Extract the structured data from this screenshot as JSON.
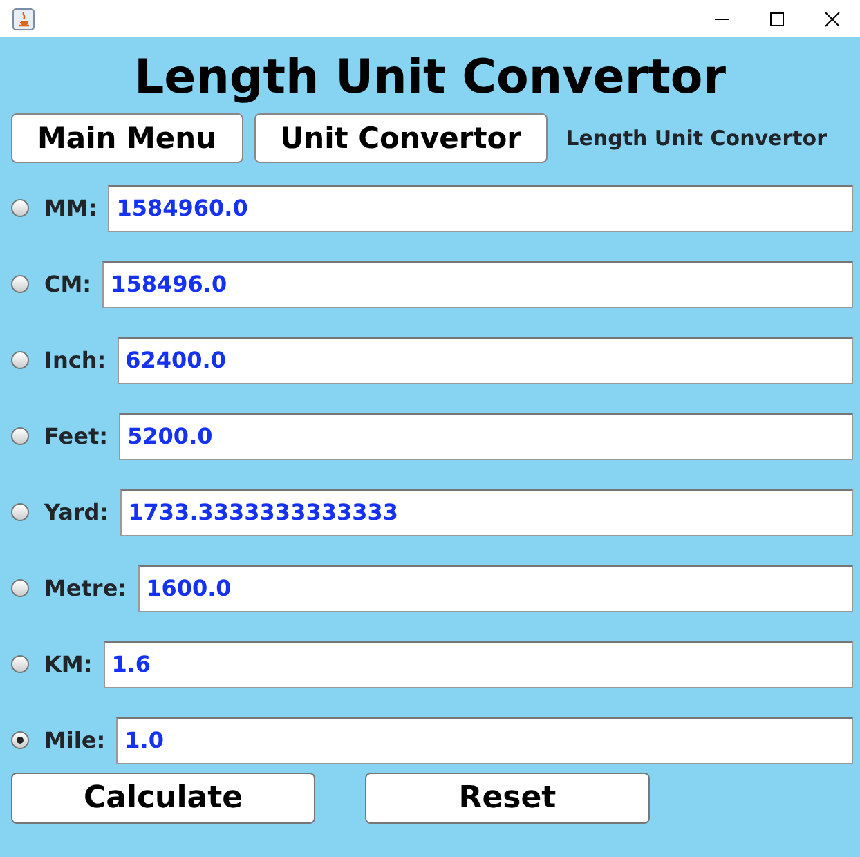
{
  "heading": "Length Unit Convertor",
  "nav_buttons": [
    "Main Menu",
    "Unit Convertor"
  ],
  "subtitle": "Length Unit Convertor",
  "units": [
    {
      "label": "MM:",
      "value": "1584960.0",
      "selected": false
    },
    {
      "label": "CM:",
      "value": "158496.0",
      "selected": false
    },
    {
      "label": "Inch:",
      "value": "62400.0",
      "selected": false
    },
    {
      "label": "Feet:",
      "value": "5200.0",
      "selected": false
    },
    {
      "label": "Yard:",
      "value": "1733.3333333333333",
      "selected": false
    },
    {
      "label": "Metre:",
      "value": "1600.0",
      "selected": false
    },
    {
      "label": "KM:",
      "value": "1.6",
      "selected": false
    },
    {
      "label": "Mile:",
      "value": "1.0",
      "selected": true
    }
  ],
  "actions": [
    "Calculate",
    "Reset"
  ]
}
